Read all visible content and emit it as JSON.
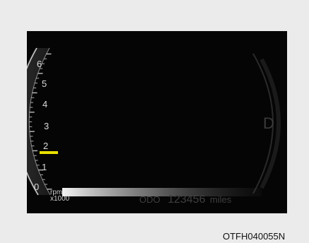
{
  "tachometer": {
    "tick_labels": [
      "6",
      "5",
      "4",
      "3",
      "2",
      "1",
      "0"
    ],
    "unit_line1": "rpm",
    "unit_line2": "x1000",
    "indicator_color": "#e8e000"
  },
  "odometer": {
    "label": "ODO",
    "value": "123456",
    "unit": "miles"
  },
  "gear_indicator": "D",
  "caption": "OTFH040055N"
}
